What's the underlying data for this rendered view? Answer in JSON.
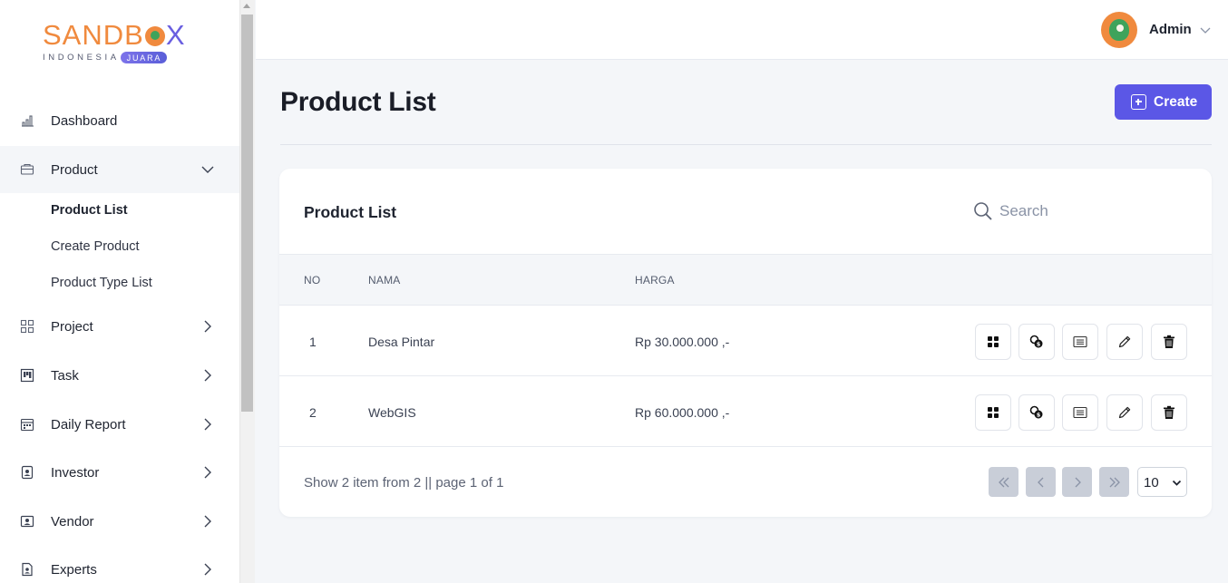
{
  "brand": {
    "name_left": "SANDB",
    "name_right": "X",
    "sub_left": "INDONESIA",
    "sub_badge": "JUARA"
  },
  "sidebar": {
    "items": [
      {
        "label": "Dashboard",
        "icon": "bar-chart-icon"
      },
      {
        "label": "Product",
        "icon": "folder-icon",
        "expanded": true
      },
      {
        "label": "Project",
        "icon": "grid-icon"
      },
      {
        "label": "Task",
        "icon": "kanban-icon"
      },
      {
        "label": "Daily Report",
        "icon": "calendar-icon"
      },
      {
        "label": "Investor",
        "icon": "badge-icon"
      },
      {
        "label": "Vendor",
        "icon": "id-card-icon"
      },
      {
        "label": "Experts",
        "icon": "file-user-icon"
      }
    ],
    "product_sub": [
      "Product List",
      "Create Product",
      "Product Type List"
    ]
  },
  "header": {
    "user_name": "Admin"
  },
  "page": {
    "title": "Product List",
    "create_label": "Create"
  },
  "card": {
    "title": "Product List",
    "search_placeholder": "Search",
    "columns": [
      "NO",
      "NAMA",
      "HARGA"
    ],
    "rows": [
      {
        "no": "1",
        "nama": "Desa Pintar",
        "harga": "Rp 30.000.000 ,-"
      },
      {
        "no": "2",
        "nama": "WebGIS",
        "harga": "Rp 60.000.000 ,-"
      }
    ],
    "footer_text": "Show 2 item from 2 || page 1 of 1",
    "page_size": "10"
  },
  "colors": {
    "accent": "#5b57e6",
    "brand_orange": "#f08a3e",
    "brand_purple": "#6a5fe0"
  }
}
